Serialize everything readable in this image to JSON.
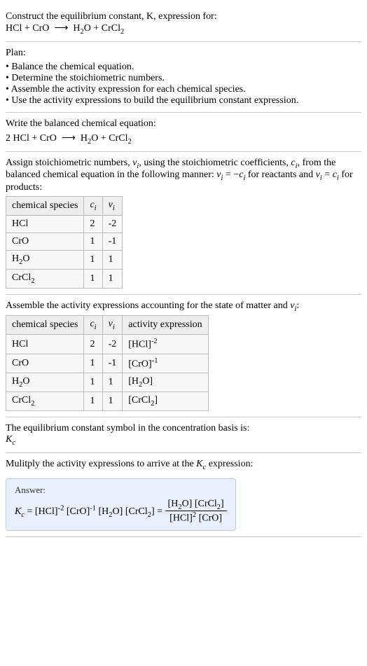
{
  "intro": {
    "line1": "Construct the equilibrium constant, K, expression for:",
    "line2_html": "HCl + CrO ⟶ H₂O + CrCl₂"
  },
  "plan": {
    "title": "Plan:",
    "items": [
      "• Balance the chemical equation.",
      "• Determine the stoichiometric numbers.",
      "• Assemble the activity expression for each chemical species.",
      "• Use the activity expressions to build the equilibrium constant expression."
    ]
  },
  "balanced": {
    "title": "Write the balanced chemical equation:",
    "eq_html": "2 HCl + CrO ⟶ H₂O + CrCl₂"
  },
  "stoich": {
    "title_html": "Assign stoichiometric numbers, νᵢ, using the stoichiometric coefficients, cᵢ, from the balanced chemical equation in the following manner: νᵢ = −cᵢ for reactants and νᵢ = cᵢ for products:",
    "headers": [
      "chemical species",
      "cᵢ",
      "νᵢ"
    ],
    "rows": [
      {
        "sp": "HCl",
        "c": "2",
        "v": "-2"
      },
      {
        "sp": "CrO",
        "c": "1",
        "v": "-1"
      },
      {
        "sp": "H₂O",
        "c": "1",
        "v": "1"
      },
      {
        "sp": "CrCl₂",
        "c": "1",
        "v": "1"
      }
    ]
  },
  "activity": {
    "title_html": "Assemble the activity expressions accounting for the state of matter and νᵢ:",
    "headers": [
      "chemical species",
      "cᵢ",
      "νᵢ",
      "activity expression"
    ],
    "rows": [
      {
        "sp": "HCl",
        "c": "2",
        "v": "-2",
        "a": "[HCl]⁻²"
      },
      {
        "sp": "CrO",
        "c": "1",
        "v": "-1",
        "a": "[CrO]⁻¹"
      },
      {
        "sp": "H₂O",
        "c": "1",
        "v": "1",
        "a": "[H₂O]"
      },
      {
        "sp": "CrCl₂",
        "c": "1",
        "v": "1",
        "a": "[CrCl₂]"
      }
    ]
  },
  "symbol": {
    "line1": "The equilibrium constant symbol in the concentration basis is:",
    "line2_html": "K_c"
  },
  "mult": {
    "title_html": "Mulitply the activity expressions to arrive at the K_c expression:"
  },
  "answer": {
    "title": "Answer:",
    "lhs_html": "K_c = [HCl]⁻² [CrO]⁻¹ [H₂O] [CrCl₂] = ",
    "frac_num": "[H₂O] [CrCl₂]",
    "frac_den": "[HCl]² [CrO]"
  },
  "chart_data": {
    "type": "table",
    "tables": [
      {
        "title": "Stoichiometric numbers",
        "columns": [
          "chemical species",
          "c_i",
          "ν_i"
        ],
        "rows": [
          [
            "HCl",
            2,
            -2
          ],
          [
            "CrO",
            1,
            -1
          ],
          [
            "H2O",
            1,
            1
          ],
          [
            "CrCl2",
            1,
            1
          ]
        ]
      },
      {
        "title": "Activity expressions",
        "columns": [
          "chemical species",
          "c_i",
          "ν_i",
          "activity expression"
        ],
        "rows": [
          [
            "HCl",
            2,
            -2,
            "[HCl]^-2"
          ],
          [
            "CrO",
            1,
            -1,
            "[CrO]^-1"
          ],
          [
            "H2O",
            1,
            1,
            "[H2O]"
          ],
          [
            "CrCl2",
            1,
            1,
            "[CrCl2]"
          ]
        ]
      }
    ],
    "balanced_equation": "2 HCl + CrO -> H2O + CrCl2",
    "equilibrium_expression": "K_c = [H2O][CrCl2] / ([HCl]^2 [CrO])"
  }
}
